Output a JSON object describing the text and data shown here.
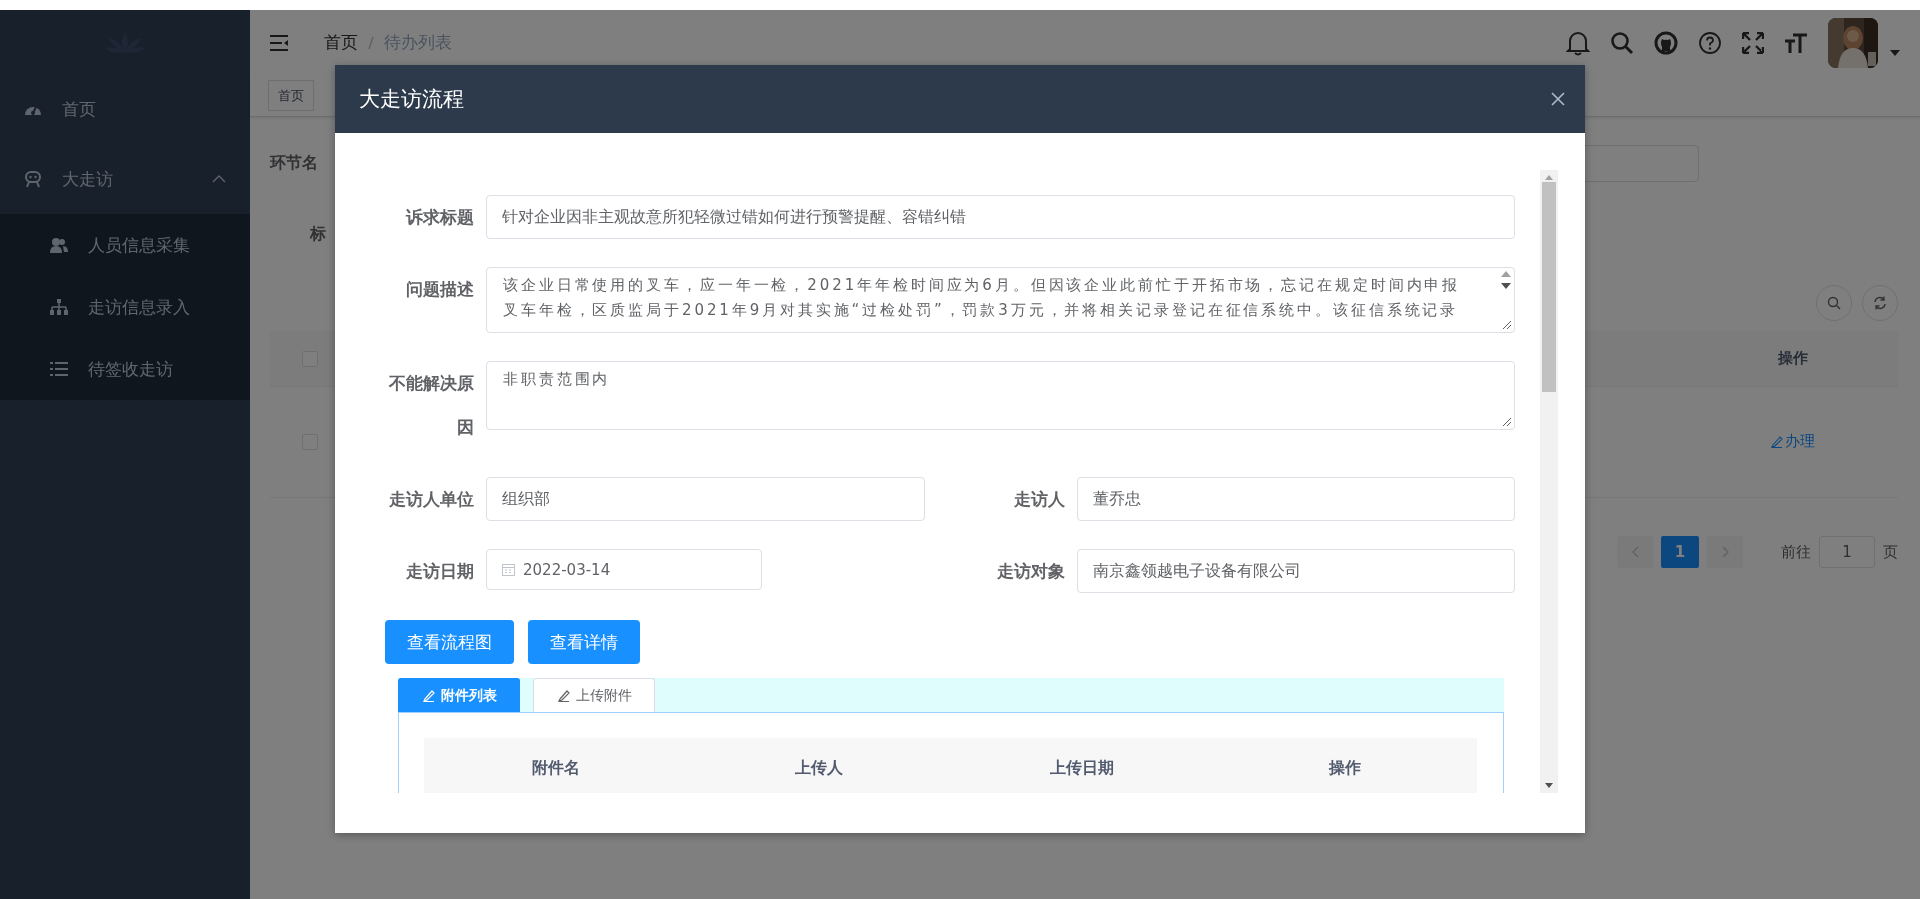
{
  "sidebar": {
    "items": [
      {
        "label": "首页"
      },
      {
        "label": "大走访",
        "expanded": true,
        "children": [
          {
            "label": "人员信息采集"
          },
          {
            "label": "走访信息录入"
          },
          {
            "label": "待签收走访"
          }
        ]
      }
    ]
  },
  "navbar": {
    "breadcrumb": [
      "首页",
      "待办列表"
    ]
  },
  "tags": [
    {
      "label": "首页"
    }
  ],
  "list_page": {
    "search_labels": [
      "环节名",
      "标"
    ],
    "table": {
      "columns": [
        "操作"
      ],
      "header_checked": false,
      "rows": [
        {
          "checked": false,
          "action": "办理"
        }
      ]
    },
    "pagination": {
      "pages": [
        {
          "label": "1",
          "selected": true
        }
      ],
      "goto_label": "前往",
      "goto_value": "1",
      "suffix": "页"
    }
  },
  "modal": {
    "title": "大走访流程",
    "form": [
      [
        {
          "kind": "input",
          "label": "诉求标题",
          "value": "针对企业因非主观故意所犯轻微过错如何进行预警提醒、容错纠错"
        }
      ],
      [
        {
          "kind": "textarea",
          "label": "问题描述",
          "lines": [
            "该企业日常使用的叉车，应一年一检，2021年年检时间应为6月。但因该企业此前忙于开拓市场，忘记在规定时间内申报",
            "叉车年检，区质监局于2021年9月对其实施“过检处罚”，罚款3万元，并将相关记录登记在征信系统中。该征信系统记录"
          ]
        }
      ],
      [
        {
          "kind": "textarea",
          "label": "不能解决原因",
          "lines": [
            "非职责范围内"
          ]
        }
      ],
      [
        {
          "kind": "input",
          "label": "走访人单位",
          "value": "组织部"
        },
        {
          "kind": "input",
          "label": "走访人",
          "value": "董乔忠"
        }
      ],
      [
        {
          "kind": "date",
          "label": "走访日期",
          "value": "2022-03-14"
        },
        {
          "kind": "input",
          "label": "走访对象",
          "value": "南京鑫领越电子设备有限公司"
        }
      ]
    ],
    "buttons": [
      "查看流程图",
      "查看详情"
    ],
    "attachment_tabs": [
      {
        "label": "附件列表",
        "selected": true
      },
      {
        "label": "上传附件",
        "selected": false
      }
    ],
    "attachment_columns": [
      "附件名",
      "上传人",
      "上传日期",
      "操作"
    ]
  }
}
